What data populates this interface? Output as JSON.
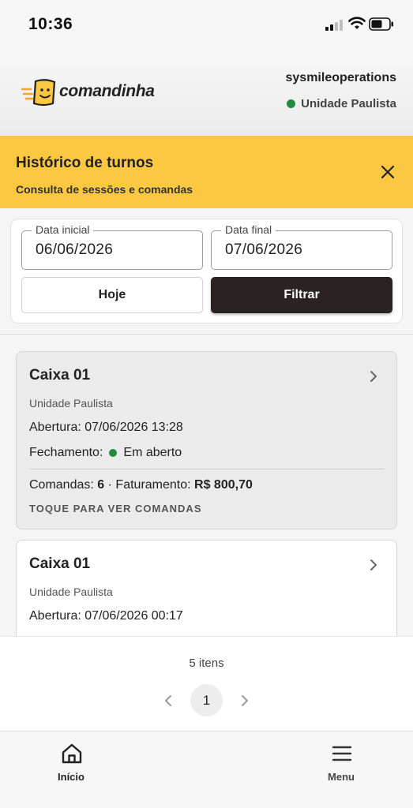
{
  "status_bar": {
    "time": "10:36"
  },
  "header": {
    "logo_text": "comandinha",
    "username": "sysmileoperations",
    "unit": "Unidade Paulista",
    "colors": {
      "brand_yellow": "#fcc842",
      "online_green": "#1e8e3e"
    }
  },
  "banner": {
    "title": "Histórico de turnos",
    "subtitle": "Consulta de sessões e comandas",
    "close_icon": "close-icon"
  },
  "filter": {
    "start_label": "Data inicial",
    "start_value": "06/06/2026",
    "end_label": "Data final",
    "end_value": "07/06/2026",
    "today_button": "Hoje",
    "filter_button": "Filtrar"
  },
  "sessions": [
    {
      "title": "Caixa 01",
      "unit": "Unidade Paulista",
      "opening": "Abertura: 07/06/2026 13:28",
      "closing_label": "Fechamento:",
      "closing_status": "Em aberto",
      "comandas_label": "Comandas:",
      "comandas_value": "6",
      "separator": "·",
      "revenue_label": "Faturamento:",
      "revenue_value": "R$ 800,70",
      "hint": "TOQUE PARA VER COMANDAS"
    },
    {
      "title": "Caixa 01",
      "unit": "Unidade Paulista",
      "opening": "Abertura: 07/06/2026 00:17"
    }
  ],
  "pagination": {
    "items_count": "5 itens",
    "current_page": "1"
  },
  "bottom_nav": {
    "home_label": "Início",
    "menu_label": "Menu"
  }
}
